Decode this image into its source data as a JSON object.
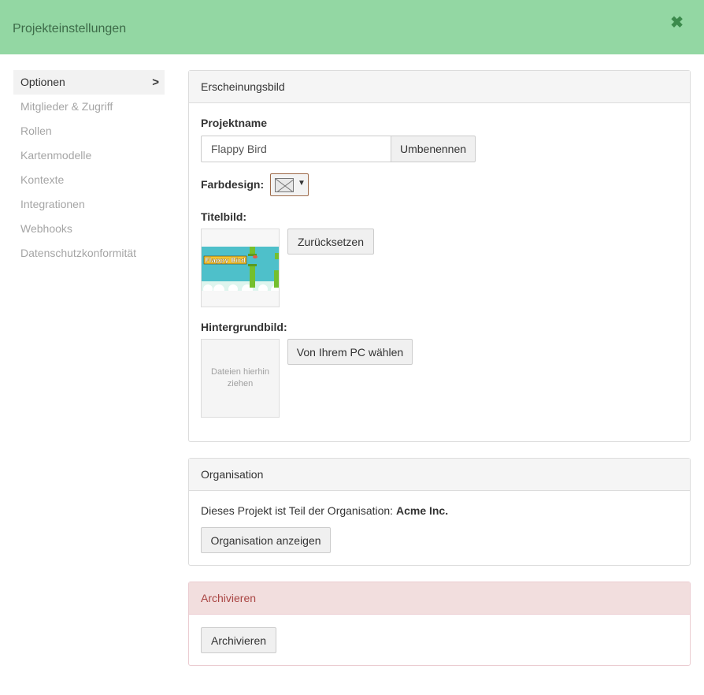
{
  "header": {
    "title": "Projekteinstellungen",
    "close_icon": "close-icon"
  },
  "sidebar": {
    "items": [
      {
        "label": "Optionen",
        "active": true
      },
      {
        "label": "Mitglieder & Zugriff"
      },
      {
        "label": "Rollen"
      },
      {
        "label": "Kartenmodelle"
      },
      {
        "label": "Kontexte"
      },
      {
        "label": "Integrationen"
      },
      {
        "label": "Webhooks"
      },
      {
        "label": "Datenschutzkonformität"
      }
    ]
  },
  "appearance": {
    "title": "Erscheinungsbild",
    "project_name_label": "Projektname",
    "project_name_value": "Flappy Bird",
    "rename_button": "Umbenennen",
    "color_design_label": "Farbdesign:",
    "color_dropdown_caret": "▼",
    "cover_label": "Titelbild:",
    "cover_image_text": "Flappy Bird",
    "reset_button": "Zurücksetzen",
    "background_label": "Hintergrundbild:",
    "dropzone_text": "Dateien hierhin ziehen",
    "choose_button": "Von Ihrem PC wählen"
  },
  "organization": {
    "title": "Organisation",
    "text": "Dieses Projekt ist Teil der Organisation:",
    "org_name": "Acme Inc.",
    "show_button": "Organisation anzeigen"
  },
  "archive": {
    "title": "Archivieren",
    "button": "Archivieren"
  },
  "colors": {
    "header_bg": "#93d7a3",
    "header_text": "#3d6b48",
    "danger_bg": "#f2dede",
    "danger_text": "#a94442",
    "sky": "#4ec0ca",
    "pipe": "#74bf2e"
  }
}
